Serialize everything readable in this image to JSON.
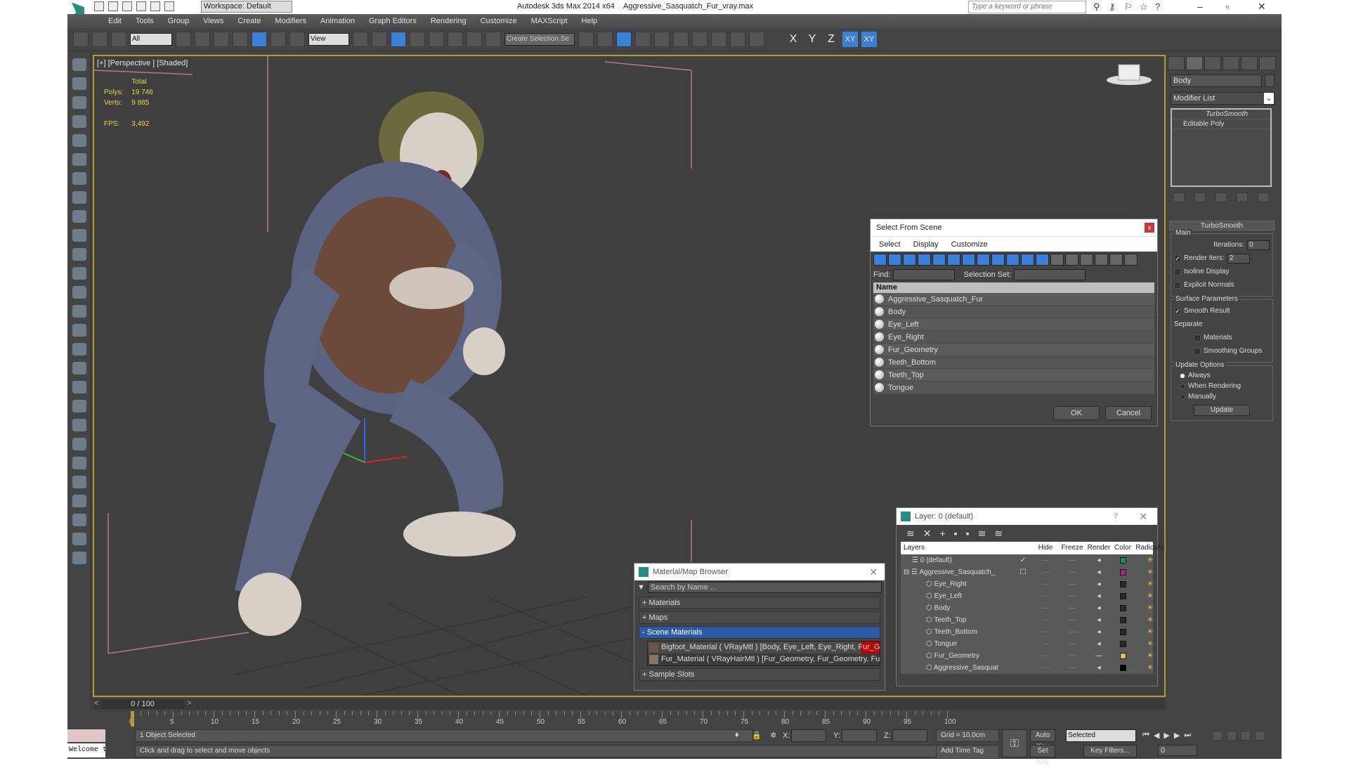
{
  "title": {
    "workspace": "Workspace: Default",
    "app": "Autodesk 3ds Max  2014 x64",
    "file": "Aggressive_Sasquatch_Fur_vray.max",
    "search_placeholder": "Type a keyword or phrase"
  },
  "menu": [
    "Edit",
    "Tools",
    "Group",
    "Views",
    "Create",
    "Modifiers",
    "Animation",
    "Graph Editors",
    "Rendering",
    "Customize",
    "MAXScript",
    "Help"
  ],
  "toolbar": {
    "filter": "All",
    "ref_coord": "View",
    "selection_set": "Create Selection Se",
    "axes": [
      "X",
      "Y",
      "Z",
      "XY",
      "XY"
    ]
  },
  "viewport": {
    "label": "[+] [Perspective ] [Shaded]",
    "stats": {
      "header": "Total",
      "polys_label": "Polys:",
      "polys": "19 746",
      "verts_label": "Verts:",
      "verts": "9 885",
      "fps_label": "FPS:",
      "fps": "3,492"
    }
  },
  "command_panel": {
    "object_name": "Body",
    "modifier_list": "Modifier List",
    "stack": [
      "TurboSmooth",
      "Editable Poly"
    ],
    "turbosmooth": {
      "title": "TurboSmooth",
      "main": "Main",
      "iterations_label": "Iterations:",
      "iterations": "0",
      "render_iters_label": "Render Iters:",
      "render_iters": "2",
      "isoline": "Isoline Display",
      "explicit_normals": "Explicit Normals",
      "surface": "Surface Parameters",
      "smooth_result": "Smooth Result",
      "separate": "Separate",
      "materials": "Materials",
      "smoothing_groups": "Smoothing Groups",
      "update_options": "Update Options",
      "always": "Always",
      "when_rendering": "When Rendering",
      "manually": "Manually",
      "update": "Update"
    }
  },
  "select_from_scene": {
    "title": "Select From Scene",
    "menu": [
      "Select",
      "Display",
      "Customize"
    ],
    "find_label": "Find:",
    "selection_set_label": "Selection Set:",
    "column": "Name",
    "items": [
      "Aggressive_Sasquatch_Fur",
      "Body",
      "Eye_Left",
      "Eye_Right",
      "Fur_Geometry",
      "Teeth_Bottom",
      "Teeth_Top",
      "Tongue"
    ],
    "ok": "OK",
    "cancel": "Cancel"
  },
  "layer_dialog": {
    "title": "Layer: 0 (default)",
    "help": "?",
    "columns": [
      "Layers",
      "",
      "Hide",
      "Freeze",
      "Render",
      "Color",
      "Radiosity"
    ],
    "rows": [
      {
        "name": "0 (default)",
        "color": "#1a8a6a"
      },
      {
        "name": "Aggressive_Sasquatch_",
        "color": "#b01a9a"
      },
      {
        "name": "Eye_Right",
        "color": "#2a2a2a"
      },
      {
        "name": "Eye_Left",
        "color": "#2a2a2a"
      },
      {
        "name": "Body",
        "color": "#2a2a2a"
      },
      {
        "name": "Teeth_Top",
        "color": "#2a2a2a"
      },
      {
        "name": "Teeth_Bottom",
        "color": "#2a2a2a"
      },
      {
        "name": "Tongue",
        "color": "#2a2a2a"
      },
      {
        "name": "Fur_Geometry",
        "color": "#e0c050"
      },
      {
        "name": "Aggressive_Sasquat",
        "color": "#000000"
      }
    ]
  },
  "material_browser": {
    "title": "Material/Map Browser",
    "search_placeholder": "Search by Name ...",
    "sections": [
      "+ Materials",
      "+ Maps",
      "- Scene Materials",
      "+ Sample Slots"
    ],
    "materials": [
      "Bigfoot_Material  ( VRayMtl ) [Body, Eye_Left, Eye_Right, Fur_G...",
      "Fur_Material  ( VRayHairMtl ) [Fur_Geometry, Fur_Geometry, Fu..."
    ]
  },
  "timeline": {
    "frame": "0 / 100",
    "ticks": [
      "0",
      "5",
      "10",
      "15",
      "20",
      "25",
      "30",
      "35",
      "40",
      "45",
      "50",
      "55",
      "60",
      "65",
      "70",
      "75",
      "80",
      "85",
      "90",
      "95",
      "100"
    ]
  },
  "status": {
    "selected": "1 Object Selected",
    "prompt": "Click and drag to select and move objects",
    "maxscript": "Welcome to M",
    "x": "X:",
    "y": "Y:",
    "z": "Z:",
    "grid": "Grid = 10,0cm",
    "add_time_tag": "Add Time Tag",
    "auto_key": "Auto Key",
    "set_key": "Set Key",
    "key_mode": "Selected",
    "key_filters": "Key Filters...",
    "current_frame": "0"
  }
}
